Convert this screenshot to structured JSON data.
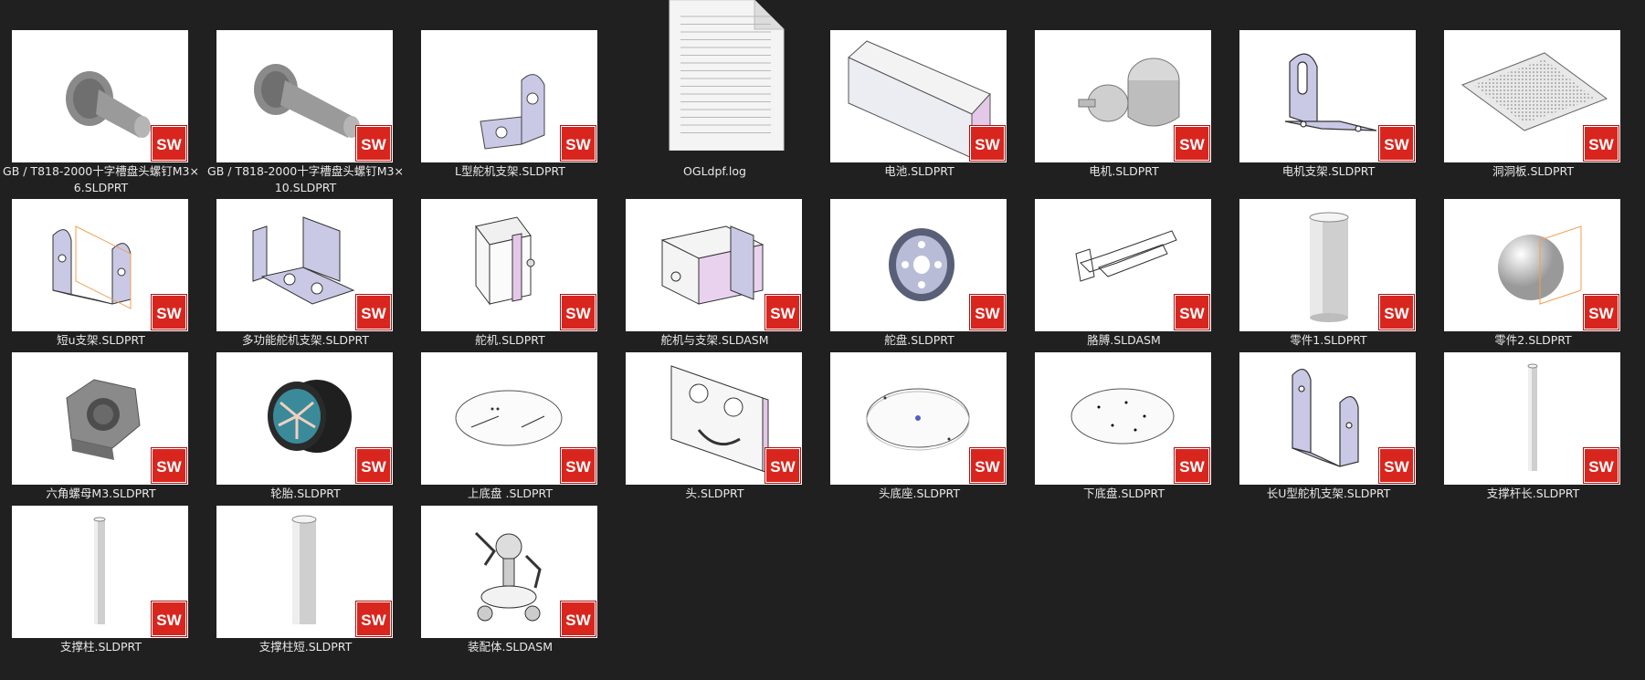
{
  "files": [
    {
      "name": "GB / T818-2000十字槽盘头螺钉M3×6.SLDPRT",
      "icon": "screw-thumbnail"
    },
    {
      "name": "GB / T818-2000十字槽盘头螺钉M3×10.SLDPRT",
      "icon": "screw-long-thumbnail"
    },
    {
      "name": "L型舵机支架.SLDPRT",
      "icon": "l-bracket-thumbnail"
    },
    {
      "name": "OGLdpf.log",
      "icon": "text-document-icon"
    },
    {
      "name": "电池.SLDPRT",
      "icon": "battery-box-thumbnail"
    },
    {
      "name": "电机.SLDPRT",
      "icon": "motor-thumbnail"
    },
    {
      "name": "电机支架.SLDPRT",
      "icon": "motor-bracket-thumbnail"
    },
    {
      "name": "洞洞板.SLDPRT",
      "icon": "perfboard-thumbnail"
    },
    {
      "name": "短u支架.SLDPRT",
      "icon": "short-u-bracket-thumbnail"
    },
    {
      "name": "多功能舵机支架.SLDPRT",
      "icon": "multi-bracket-thumbnail"
    },
    {
      "name": "舵机.SLDPRT",
      "icon": "servo-thumbnail"
    },
    {
      "name": "舵机与支架.SLDASM",
      "icon": "servo-assembly-thumbnail"
    },
    {
      "name": "舵盘.SLDPRT",
      "icon": "servo-horn-thumbnail"
    },
    {
      "name": "胳膊.SLDASM",
      "icon": "arm-assembly-thumbnail"
    },
    {
      "name": "零件1.SLDPRT",
      "icon": "cylinder-thumbnail"
    },
    {
      "name": "零件2.SLDPRT",
      "icon": "sphere-thumbnail"
    },
    {
      "name": "六角螺母M3.SLDPRT",
      "icon": "hex-nut-thumbnail"
    },
    {
      "name": "轮胎.SLDPRT",
      "icon": "wheel-thumbnail"
    },
    {
      "name": "上底盘 .SLDPRT",
      "icon": "upper-chassis-thumbnail"
    },
    {
      "name": "头.SLDPRT",
      "icon": "head-plate-thumbnail"
    },
    {
      "name": "头底座.SLDPRT",
      "icon": "head-base-thumbnail"
    },
    {
      "name": "下底盘.SLDPRT",
      "icon": "lower-chassis-thumbnail"
    },
    {
      "name": "长U型舵机支架.SLDPRT",
      "icon": "long-u-bracket-thumbnail"
    },
    {
      "name": "支撑杆长.SLDPRT",
      "icon": "long-rod-thumbnail"
    },
    {
      "name": "支撑柱.SLDPRT",
      "icon": "support-column-thumbnail"
    },
    {
      "name": "支撑柱短.SLDPRT",
      "icon": "short-column-thumbnail"
    },
    {
      "name": "装配体.SLDASM",
      "icon": "robot-assembly-thumbnail"
    }
  ],
  "badge": {
    "text": "SW",
    "color": "#d8261e"
  },
  "colors": {
    "background": "#202020",
    "thumb": "#ffffff",
    "label": "#e8e8e8"
  }
}
